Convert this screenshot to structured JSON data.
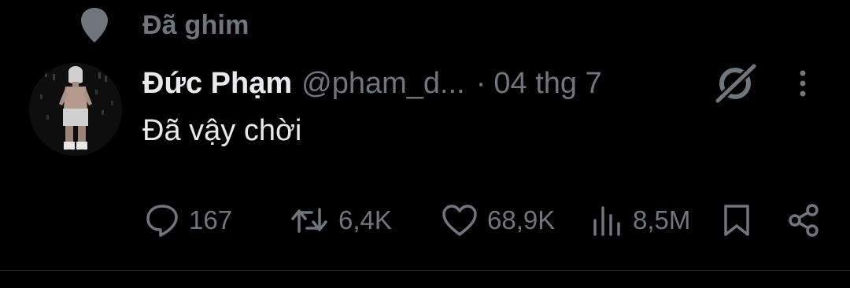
{
  "pinned": {
    "label": "Đã ghim",
    "icon": "pin-icon"
  },
  "author": {
    "display_name": "Đức Phạm",
    "handle": "@pham_d...",
    "separator": "·",
    "date": "04 thg 7",
    "avatar_icon": "avatar"
  },
  "tweet": {
    "text": "Đã vậy chời"
  },
  "actions": {
    "reply": {
      "icon": "reply-icon",
      "count": "167"
    },
    "retweet": {
      "icon": "retweet-icon",
      "count": "6,4K"
    },
    "like": {
      "icon": "heart-icon",
      "count": "68,9K"
    },
    "views": {
      "icon": "views-icon",
      "count": "8,5M"
    },
    "bookmark": {
      "icon": "bookmark-icon"
    },
    "share": {
      "icon": "share-icon"
    }
  },
  "colors": {
    "background": "#000000",
    "primary_text": "#e7e9ea",
    "secondary_text": "#71767b",
    "divider": "#2f3336"
  }
}
